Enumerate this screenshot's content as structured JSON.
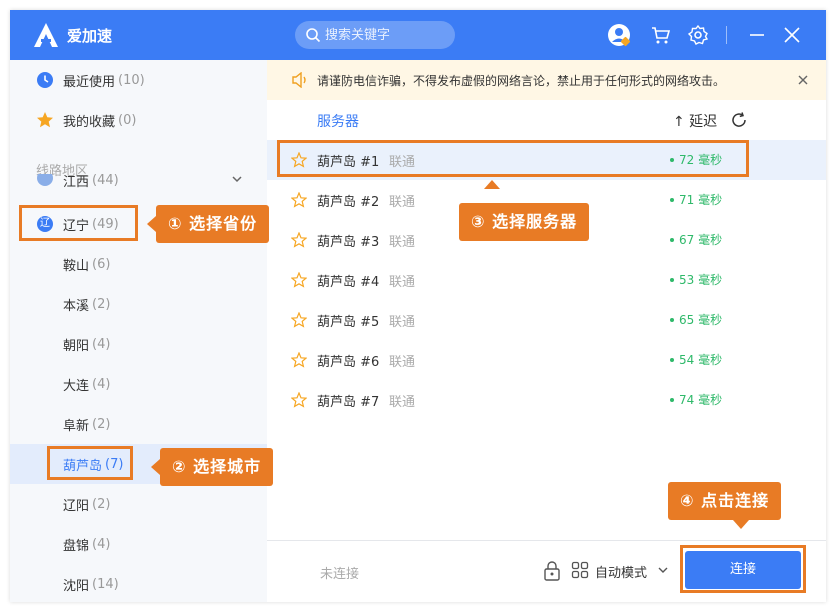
{
  "app": {
    "title": "爱加速"
  },
  "titlebar": {
    "search_placeholder": "搜索关键字"
  },
  "sidebar": {
    "recent_label": "最近使用",
    "recent_count": "(10)",
    "favorites_label": "我的收藏",
    "favorites_count": "(0)",
    "section_title": "线路地区",
    "partial_province": {
      "label": "江西",
      "count": "(44)"
    },
    "selected_province": {
      "label": "辽宁",
      "count": "(49)",
      "badge": "辽"
    },
    "cities": [
      {
        "label": "鞍山",
        "count": "(6)"
      },
      {
        "label": "本溪",
        "count": "(2)"
      },
      {
        "label": "朝阳",
        "count": "(4)"
      },
      {
        "label": "大连",
        "count": "(4)"
      },
      {
        "label": "阜新",
        "count": "(2)"
      },
      {
        "label": "葫芦岛",
        "count": "(7)"
      },
      {
        "label": "辽阳",
        "count": "(2)"
      },
      {
        "label": "盘锦",
        "count": "(4)"
      },
      {
        "label": "沈阳",
        "count": "(14)"
      }
    ]
  },
  "notice": {
    "text": "请谨防电信诈骗，不得发布虚假的网络言论，禁止用于任何形式的网络攻击。"
  },
  "list": {
    "header_server": "服务器",
    "header_latency": "↑ 延迟",
    "servers": [
      {
        "name": "葫芦岛 #1",
        "isp": "联通",
        "latency": "72 毫秒"
      },
      {
        "name": "葫芦岛 #2",
        "isp": "联通",
        "latency": "71 毫秒"
      },
      {
        "name": "葫芦岛 #3",
        "isp": "联通",
        "latency": "67 毫秒"
      },
      {
        "name": "葫芦岛 #4",
        "isp": "联通",
        "latency": "53 毫秒"
      },
      {
        "name": "葫芦岛 #5",
        "isp": "联通",
        "latency": "65 毫秒"
      },
      {
        "name": "葫芦岛 #6",
        "isp": "联通",
        "latency": "54 毫秒"
      },
      {
        "name": "葫芦岛 #7",
        "isp": "联通",
        "latency": "74 毫秒"
      }
    ]
  },
  "bottombar": {
    "status": "未连接",
    "mode": "自动模式",
    "connect_label": "连接"
  },
  "tutorial": {
    "step1": "① 选择省份",
    "step2": "② 选择城市",
    "step3": "③ 选择服务器",
    "step4": "④ 点击连接"
  },
  "colors": {
    "brand": "#3b7cf5",
    "accent": "#e87b25",
    "latency_good": "#2fb96a",
    "notice_bg": "#fff7e5"
  },
  "icons": [
    "logo-icon",
    "search-icon",
    "avatar-icon",
    "cart-icon",
    "gear-icon",
    "minimize-icon",
    "close-icon",
    "clock-icon",
    "star-icon",
    "chevron-down-icon",
    "speaker-icon",
    "refresh-icon",
    "lock-icon",
    "grid-icon"
  ]
}
